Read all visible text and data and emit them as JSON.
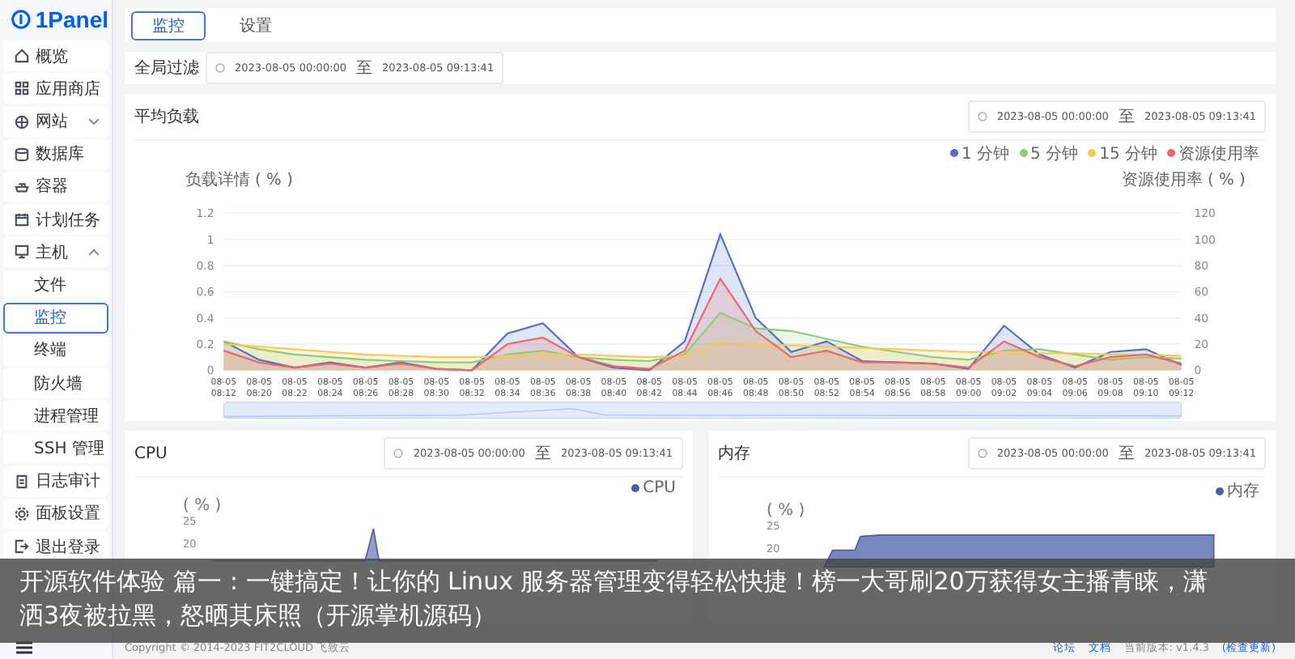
{
  "sidebar": {
    "logo": "1Panel",
    "items": [
      {
        "label": "概览",
        "selected": false
      },
      {
        "label": "应用商店",
        "selected": false
      },
      {
        "label": "网站",
        "selected": false,
        "expanded": false
      },
      {
        "label": "数据库",
        "selected": false
      },
      {
        "label": "容器",
        "selected": false
      },
      {
        "label": "计划任务",
        "selected": false
      },
      {
        "label": "主机",
        "selected": false,
        "expanded": true,
        "children": [
          {
            "label": "文件",
            "selected": false
          },
          {
            "label": "监控",
            "selected": true
          },
          {
            "label": "终端",
            "selected": false
          },
          {
            "label": "防火墙",
            "selected": false
          },
          {
            "label": "进程管理",
            "selected": false
          },
          {
            "label": "SSH 管理",
            "selected": false
          }
        ]
      },
      {
        "label": "日志审计",
        "selected": false
      },
      {
        "label": "面板设置",
        "selected": false
      },
      {
        "label": "退出登录",
        "selected": false
      }
    ]
  },
  "tabs": [
    {
      "label": "监控",
      "selected": true
    },
    {
      "label": "设置",
      "selected": false
    }
  ],
  "filter": {
    "label": "全局过滤",
    "start": "2023-08-05 00:00:00",
    "separator": "至",
    "end": "2023-08-05 09:13:41"
  },
  "load_card": {
    "title": "平均负载",
    "start": "2023-08-05 00:00:00",
    "separator": "至",
    "end": "2023-08-05 09:13:41",
    "chart_data": {
      "type": "area",
      "grid": true,
      "ylabel": "负载详情 ( % )",
      "ylim": [
        0,
        1.2
      ],
      "yticks": [
        0,
        0.2,
        0.4,
        0.6,
        0.8,
        1,
        1.2
      ],
      "y2label": "资源使用率 ( % )",
      "y2lim": [
        0,
        120
      ],
      "y2ticks": [
        0,
        20,
        40,
        60,
        80,
        100,
        120
      ],
      "categories": [
        "08-05 08:12",
        "08-05 08:20",
        "08-05 08:22",
        "08-05 08:24",
        "08-05 08:26",
        "08-05 08:28",
        "08-05 08:30",
        "08-05 08:32",
        "08-05 08:34",
        "08-05 08:36",
        "08-05 08:38",
        "08-05 08:40",
        "08-05 08:42",
        "08-05 08:44",
        "08-05 08:46",
        "08-05 08:48",
        "08-05 08:50",
        "08-05 08:52",
        "08-05 08:54",
        "08-05 08:56",
        "08-05 08:58",
        "08-05 09:00",
        "08-05 09:02",
        "08-05 09:04",
        "08-05 09:06",
        "08-05 09:08",
        "08-05 09:10",
        "08-05 09:12"
      ],
      "series": [
        {
          "name": "1 分钟",
          "color": "#5470c6",
          "values": [
            0.22,
            0.08,
            0.02,
            0.06,
            0.02,
            0.06,
            0.01,
            0.0,
            0.28,
            0.36,
            0.1,
            0.02,
            0.0,
            0.22,
            1.04,
            0.4,
            0.14,
            0.22,
            0.07,
            0.06,
            0.05,
            0.01,
            0.34,
            0.12,
            0.02,
            0.14,
            0.16,
            0.04
          ]
        },
        {
          "name": "5 分钟",
          "color": "#91cc75",
          "values": [
            0.22,
            0.16,
            0.12,
            0.1,
            0.08,
            0.07,
            0.06,
            0.06,
            0.12,
            0.15,
            0.1,
            0.08,
            0.07,
            0.12,
            0.44,
            0.32,
            0.3,
            0.24,
            0.18,
            0.14,
            0.1,
            0.08,
            0.15,
            0.16,
            0.12,
            0.08,
            0.1,
            0.09
          ]
        },
        {
          "name": "15 分钟",
          "color": "#fac858",
          "values": [
            0.2,
            0.18,
            0.16,
            0.14,
            0.12,
            0.11,
            0.1,
            0.1,
            0.11,
            0.12,
            0.12,
            0.11,
            0.1,
            0.11,
            0.22,
            0.2,
            0.19,
            0.18,
            0.17,
            0.16,
            0.15,
            0.14,
            0.14,
            0.13,
            0.13,
            0.12,
            0.12,
            0.11
          ]
        },
        {
          "name": "资源使用率",
          "color": "#ee6666",
          "axis": "y2",
          "values": [
            15,
            6,
            2,
            5,
            2,
            5,
            1,
            0,
            20,
            25,
            10,
            3,
            1,
            15,
            70,
            30,
            10,
            15,
            6,
            6,
            5,
            2,
            22,
            10,
            3,
            10,
            12,
            5
          ]
        }
      ]
    }
  },
  "cpu_card": {
    "title": "CPU",
    "start": "2023-08-05 00:00:00",
    "separator": "至",
    "end": "2023-08-05 09:13:41",
    "legend": "CPU",
    "unit": "( % )",
    "ticks": [
      "25",
      "20"
    ]
  },
  "memory_card": {
    "title": "内存",
    "start": "2023-08-05 00:00:00",
    "separator": "至",
    "end": "2023-08-05 09:13:41",
    "legend": "内存",
    "unit": "( % )",
    "ticks": [
      "25",
      "20"
    ]
  },
  "footer": {
    "copyright": "Copyright © 2014-2023 FIT2CLOUD 飞致云",
    "links": [
      "论坛",
      "文档"
    ],
    "version": "当前版本: v1.4.3",
    "update": "(检查更新)"
  },
  "caption": "开源软件体验 篇一：一键搞定！让你的 Linux 服务器管理变得轻松快捷！榜一大哥刷20万获得女主播青睐，潇洒3夜被拉黑，怒晒其床照（开源掌机源码）"
}
